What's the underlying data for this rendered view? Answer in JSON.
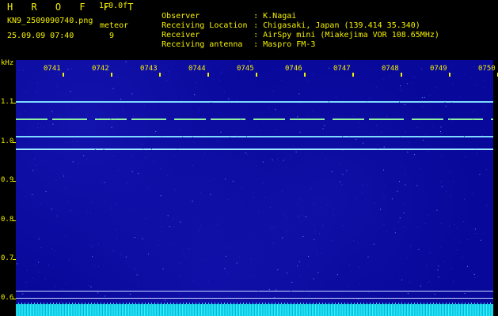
{
  "header": {
    "program_title": "H R O F F T",
    "version": "1.0.0f",
    "filename": "KN9_2509090740.png",
    "meteor_label": "meteor",
    "datetime": "25.09.09 07:40",
    "meteor_count": "9"
  },
  "info": [
    {
      "label": "Observer",
      "value": ": K.Nagai"
    },
    {
      "label": "Receiving Location",
      "value": ": Chigasaki, Japan (139.414 35.340)"
    },
    {
      "label": "Receiver",
      "value": ": AirSpy mini (Miakejima VOR 108.65MHz)"
    },
    {
      "label": "Receiving antenna",
      "value": ": Maspro FM-3"
    }
  ],
  "chart_data": {
    "type": "heatmap",
    "ylabel": "kHz",
    "y_ticks": [
      "1.1",
      "1.0",
      "0.9",
      "0.8",
      "0.7",
      "0.6"
    ],
    "x_ticks": [
      "0741",
      "0742",
      "0743",
      "0744",
      "0745",
      "0746",
      "0747",
      "0748",
      "0749",
      "0750"
    ],
    "signal_lines": [
      {
        "freq_khz": 1.105,
        "color": "#7fd8ff"
      },
      {
        "freq_khz": 1.06,
        "color": "#8ef0a0"
      },
      {
        "freq_khz": 1.015,
        "color": "#7fd8ff"
      },
      {
        "freq_khz": 0.983,
        "color": "#9fe8ff"
      },
      {
        "freq_khz": 0.62,
        "color": "#c8d8ff"
      },
      {
        "freq_khz": 0.602,
        "color": "#c8d8ff"
      }
    ],
    "colors": {
      "background": "#08089a",
      "axis_text": "#f4f000",
      "noise_band": "#22e6f0"
    }
  }
}
